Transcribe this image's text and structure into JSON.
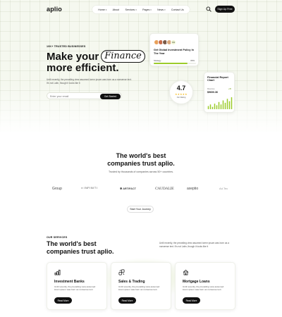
{
  "brand": {
    "logo": "aplio"
  },
  "nav": {
    "items": [
      {
        "label": "Home",
        "caret": true
      },
      {
        "label": "About",
        "caret": false
      },
      {
        "label": "Services",
        "caret": true
      },
      {
        "label": "Pages",
        "caret": true
      },
      {
        "label": "News",
        "caret": true
      },
      {
        "label": "Contact Us",
        "caret": false
      }
    ],
    "signup_label": "Sign Up Free",
    "search_icon": "search-icon"
  },
  "hero": {
    "trusted": "10K+ TRUSTED BUSINESSES",
    "headline_pre": "Make your",
    "headline_pill": "Finance",
    "headline_2": "more efficient.",
    "description": "Until recently, the prevailing view assumed lorem ipsum was born as a nonsense text. It's not Latin, though it looks like it",
    "email_placeholder": "Enter your email",
    "email_value": "",
    "cta_label": "Get Started"
  },
  "policy_card": {
    "avatars_more": "10k",
    "title": "Get Global Investment Policy In The Year",
    "progress_label": "Strategy",
    "progress_pct": "80%",
    "progress_value": 0.8,
    "avatar_colors": [
      "#e8a05a",
      "#c66b4a",
      "#7a5a47",
      "#d9a679"
    ]
  },
  "rating_card": {
    "value": "4.7",
    "stars": "★★★★★",
    "label": "Our Rating"
  },
  "report_card": {
    "title": "Financial Report Chart",
    "sub": "Revenue",
    "amount": "$9600.36",
    "badge": "+45",
    "bars": [
      4,
      6,
      3,
      7,
      5,
      9,
      6,
      11,
      8,
      13,
      10,
      15
    ]
  },
  "companies": {
    "title": "The world's best companies trust aplio.",
    "subtitle": "Trusted by thousands of companies across 50+ countries.",
    "logos": [
      "Group",
      "INFINITI",
      "ARTIFACT",
      "CAUDALIE",
      "axeptio",
      "Ad.Tec"
    ],
    "journey_label": "Start Your Journey"
  },
  "services": {
    "label": "OUR SERVICES",
    "title": "The world's best companies trust aplio.",
    "description": "Until recently, the prevailing view assumed lorem ipsum was born as a nonsense text. It's not Latin, though it looks like it",
    "cards": [
      {
        "icon": "investment-icon",
        "title": "Investment Banks",
        "desc": "Until recently, the prevailing view assumed lorem ipsum was born as nonsense text.",
        "button": "Read More"
      },
      {
        "icon": "trading-icon",
        "title": "Sales & Trading",
        "desc": "Until recently, the prevailing view assumed lorem ipsum was born as nonsense text.",
        "button": "Read More"
      },
      {
        "icon": "mortgage-icon",
        "title": "Mortgage Loans",
        "desc": "Until recently, the prevailing view assumed lorem ipsum was born as nonsense text.",
        "button": "Read More"
      }
    ]
  },
  "colors": {
    "accent": "#9ccc2b",
    "dark": "#111111",
    "hero_bg": "#f5f8ef"
  }
}
